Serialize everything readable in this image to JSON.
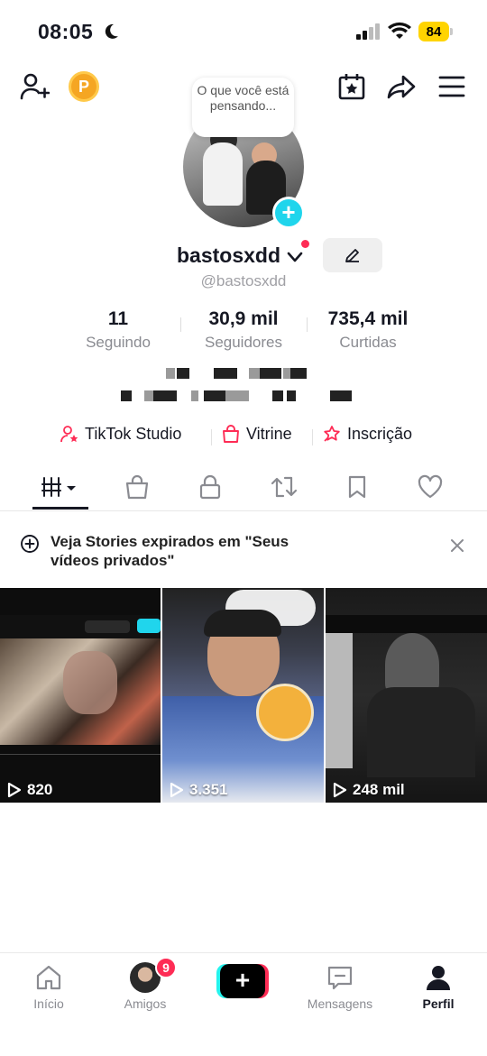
{
  "status_bar": {
    "time": "08:05",
    "battery": "84",
    "icons": [
      "moon-icon",
      "signal-icon",
      "wifi-icon",
      "battery-icon"
    ]
  },
  "header": {
    "coin_label": "P",
    "thought_bubble": "O que você está pensando..."
  },
  "profile": {
    "username": "bastosxdd",
    "handle": "@bastosxdd",
    "stats": [
      {
        "value": "11",
        "label": "Seguindo"
      },
      {
        "value": "30,9 mil",
        "label": "Seguidores"
      },
      {
        "value": "735,4 mil",
        "label": "Curtidas"
      }
    ]
  },
  "links": [
    {
      "label": "TikTok Studio",
      "icon": "studio-icon"
    },
    {
      "label": "Vitrine",
      "icon": "shopping-bag-icon"
    },
    {
      "label": "Inscrição",
      "icon": "subscription-icon"
    }
  ],
  "tabs": [
    "videos-grid-tab",
    "shop-tab",
    "private-tab",
    "reposts-tab",
    "favorites-tab",
    "liked-tab"
  ],
  "banner": {
    "text_line1": "Veja Stories expirados em \"Seus",
    "text_line2": "vídeos privados\""
  },
  "videos": [
    {
      "views": "820"
    },
    {
      "views": "3.351"
    },
    {
      "views": "248 mil"
    }
  ],
  "nav": {
    "items": [
      {
        "label": "Início"
      },
      {
        "label": "Amigos",
        "badge": "9"
      },
      {
        "label": ""
      },
      {
        "label": "Mensagens"
      },
      {
        "label": "Perfil"
      }
    ]
  },
  "colors": {
    "accent_pink": "#fe2c55",
    "accent_cyan": "#25f4ee",
    "plus_blue": "#20d5ec",
    "battery_yellow": "#ffd400"
  }
}
